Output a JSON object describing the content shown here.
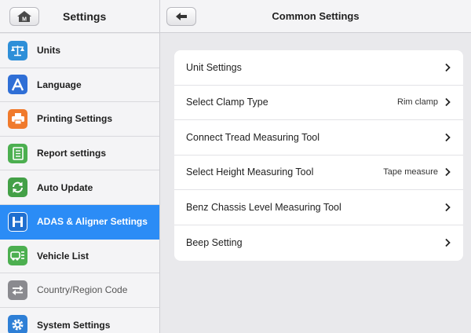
{
  "header": {
    "left_title": "Settings",
    "right_title": "Common Settings",
    "home_badge": "M"
  },
  "sidebar": {
    "items": [
      {
        "label": "Units",
        "icon": "scale-icon",
        "color": "#2e8fd8"
      },
      {
        "label": "Language",
        "icon": "letter-a-icon",
        "color": "#2f6fd6"
      },
      {
        "label": "Printing Settings",
        "icon": "printer-icon",
        "color": "#f07a2c"
      },
      {
        "label": "Report settings",
        "icon": "report-icon",
        "color": "#4caf50"
      },
      {
        "label": "Auto Update",
        "icon": "refresh-icon",
        "color": "#43a047"
      },
      {
        "label": "ADAS & Aligner Settings",
        "icon": "adas-icon",
        "color": "#2b8cf6",
        "active": true
      },
      {
        "label": "Vehicle List",
        "icon": "vehicle-list-icon",
        "color": "#4caf50"
      },
      {
        "label": "Country/Region Code",
        "icon": "swap-icon",
        "color": "#8a8a8f"
      },
      {
        "label": "System Settings",
        "icon": "gear-icon",
        "color": "#2e7fd6"
      }
    ]
  },
  "main": {
    "rows": [
      {
        "label": "Unit Settings",
        "value": ""
      },
      {
        "label": "Select Clamp Type",
        "value": "Rim clamp"
      },
      {
        "label": "Connect Tread Measuring Tool",
        "value": ""
      },
      {
        "label": "Select Height Measuring Tool",
        "value": "Tape measure"
      },
      {
        "label": "Benz Chassis Level Measuring Tool",
        "value": ""
      },
      {
        "label": "Beep Setting",
        "value": ""
      }
    ]
  },
  "colors": {
    "accent": "#2b8cf6",
    "background": "#e9e9ec",
    "card": "#ffffff"
  }
}
